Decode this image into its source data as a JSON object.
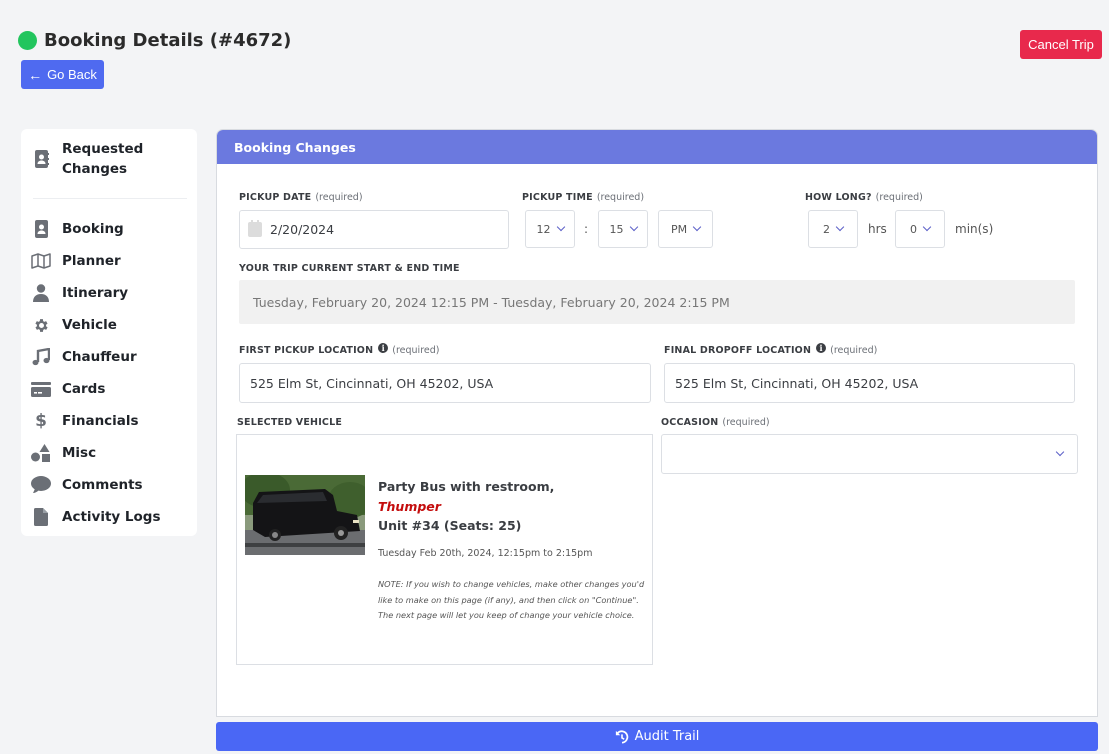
{
  "header": {
    "title": "Booking Details (#4672)",
    "status_color": "#22c55e",
    "go_back_label": "Go Back",
    "cancel_trip_label": "Cancel Trip"
  },
  "sidebar": {
    "items": [
      {
        "label": "Requested Changes",
        "icon": "address-book-icon"
      },
      {
        "label": "Booking",
        "icon": "address-book-icon"
      },
      {
        "label": "Planner",
        "icon": "map-icon"
      },
      {
        "label": "Itinerary",
        "icon": "user-icon"
      },
      {
        "label": "Vehicle",
        "icon": "gear-icon"
      },
      {
        "label": "Chauffeur",
        "icon": "music-icon"
      },
      {
        "label": "Cards",
        "icon": "credit-card-icon"
      },
      {
        "label": "Financials",
        "icon": "dollar-icon"
      },
      {
        "label": "Misc",
        "icon": "shapes-icon"
      },
      {
        "label": "Comments",
        "icon": "comment-icon"
      },
      {
        "label": "Activity Logs",
        "icon": "file-icon"
      }
    ]
  },
  "card": {
    "title": "Booking Changes",
    "required_text": "(required)",
    "pickup_date": {
      "label": "PICKUP DATE",
      "value": "2/20/2024"
    },
    "pickup_time": {
      "label": "PICKUP TIME",
      "hour": "12",
      "minute": "15",
      "separator": ":",
      "ampm": "PM"
    },
    "how_long": {
      "label": "HOW LONG?",
      "hours": "2",
      "hours_unit": "hrs",
      "minutes": "0",
      "minutes_unit": "min(s)"
    },
    "trip_time": {
      "label": "YOUR TRIP CURRENT START & END TIME",
      "value": "Tuesday, February 20, 2024 12:15 PM - Tuesday, February 20, 2024 2:15 PM"
    },
    "first_pickup": {
      "label": "FIRST PICKUP LOCATION",
      "value": "525 Elm St, Cincinnati, OH 45202, USA"
    },
    "final_dropoff": {
      "label": "FINAL DROPOFF LOCATION",
      "value": "525 Elm St, Cincinnati, OH 45202, USA"
    },
    "selected_vehicle": {
      "label": "SELECTED VEHICLE",
      "name": "Party Bus with restroom,",
      "nickname": "Thumper",
      "unit": "Unit #34 (Seats: 25)",
      "time": "Tuesday Feb 20th, 2024, 12:15pm to 2:15pm",
      "note": "NOTE: If you wish to change vehicles, make other changes you'd like to make on this page (if any), and then click on \"Continue\". The next page will let you keep of change your vehicle choice."
    },
    "occasion": {
      "label": "OCCASION",
      "value": ""
    }
  },
  "footer": {
    "audit_trail_label": "Audit Trail"
  }
}
